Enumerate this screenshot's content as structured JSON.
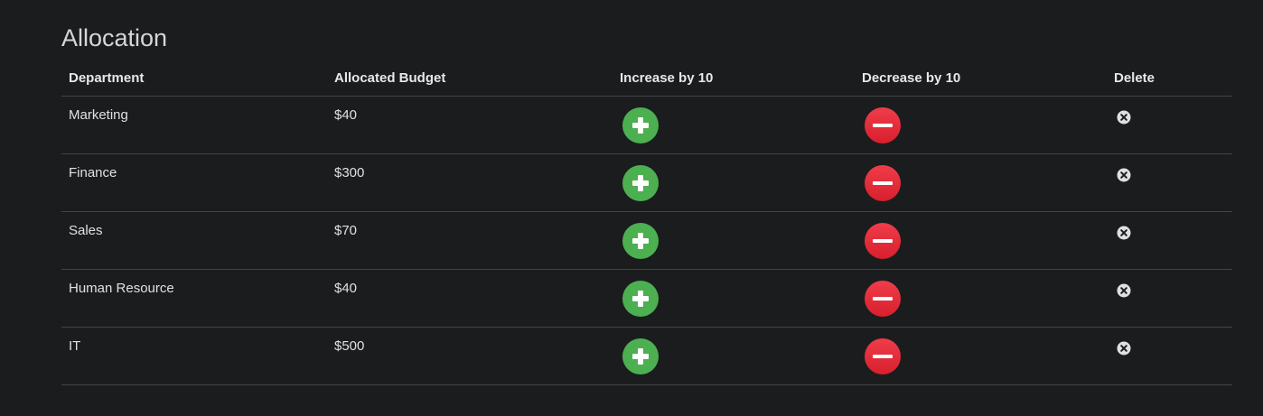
{
  "title": "Allocation",
  "columns": {
    "department": "Department",
    "budget": "Allocated Budget",
    "increase": "Increase by 10",
    "decrease": "Decrease by 10",
    "delete": "Delete"
  },
  "rows": [
    {
      "department": "Marketing",
      "budget": "$40"
    },
    {
      "department": "Finance",
      "budget": "$300"
    },
    {
      "department": "Sales",
      "budget": "$70"
    },
    {
      "department": "Human Resource",
      "budget": "$40"
    },
    {
      "department": "IT",
      "budget": "$500"
    }
  ],
  "icons": {
    "increase": "plus-circle-icon",
    "decrease": "minus-circle-icon",
    "delete": "x-circle-icon"
  },
  "colors": {
    "background": "#1b1c1e",
    "increase": "#4caf50",
    "decrease": "#e32d3b",
    "delete": "#e0e0e0"
  }
}
